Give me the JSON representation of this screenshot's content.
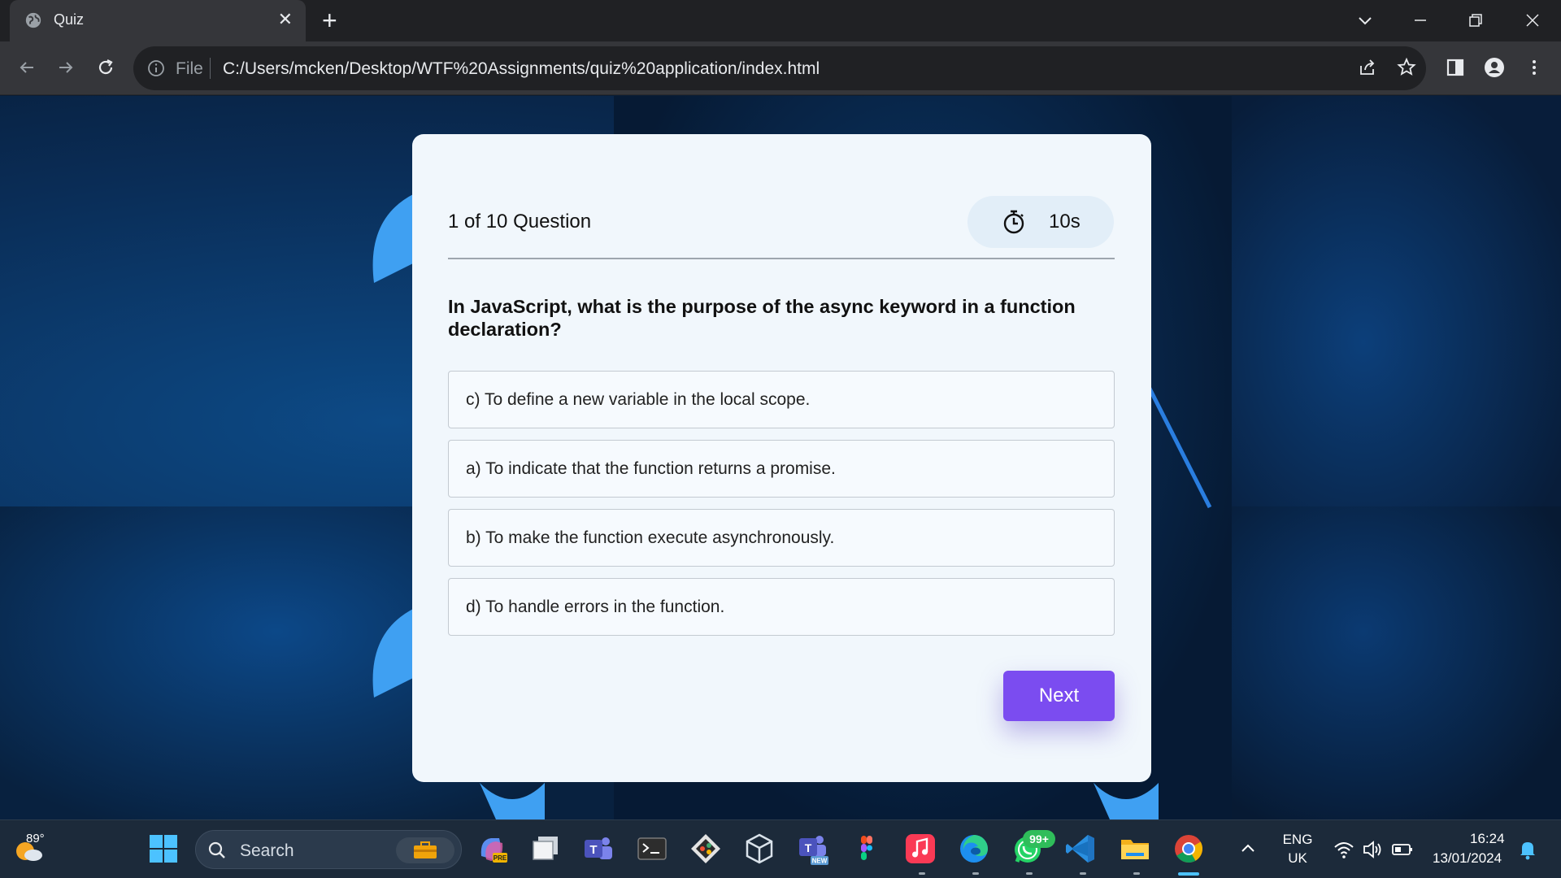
{
  "browser": {
    "tab_title": "Quiz",
    "close_glyph": "✕",
    "new_tab_glyph": "+",
    "url_scheme_label": "File",
    "url": "C:/Users/mcken/Desktop/WTF%20Assignments/quiz%20application/index.html"
  },
  "quiz": {
    "progress_text": "1 of 10 Question",
    "timer_text": "10s",
    "question": "In JavaScript, what is the purpose of the async keyword in a function declaration?",
    "options": [
      "c) To define a new variable in the local scope.",
      "a) To indicate that the function returns a promise.",
      "b) To make the function execute asynchronously.",
      "d) To handle errors in the function."
    ],
    "next_label": "Next",
    "accent_color": "#7b4cf0"
  },
  "taskbar": {
    "weather_temp": "89°",
    "search_placeholder": "Search",
    "notification_badge": "99+",
    "language_primary": "ENG",
    "language_region": "UK",
    "time": "16:24",
    "date": "13/01/2024"
  }
}
